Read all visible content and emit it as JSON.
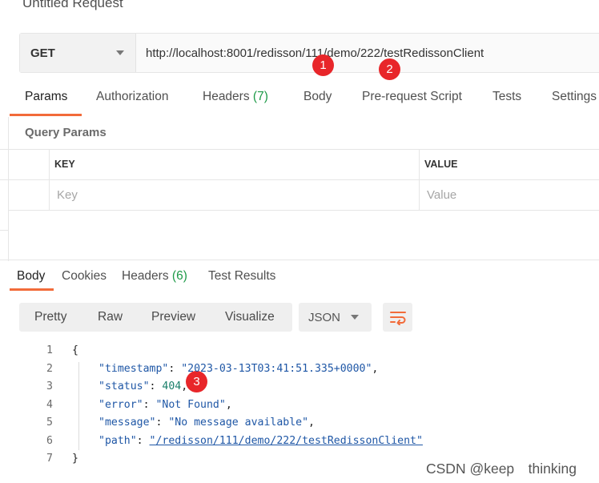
{
  "request": {
    "title": "Untitled Request",
    "method": "GET",
    "url": "http://localhost:8001/redisson/111/demo/222/testRedissonClient"
  },
  "markers": [
    "1",
    "2",
    "3"
  ],
  "request_tabs": [
    {
      "label": "Params",
      "count": ""
    },
    {
      "label": "Authorization",
      "count": ""
    },
    {
      "label": "Headers",
      "count": "(7)"
    },
    {
      "label": "Body",
      "count": ""
    },
    {
      "label": "Pre-request Script",
      "count": ""
    },
    {
      "label": "Tests",
      "count": ""
    },
    {
      "label": "Settings",
      "count": ""
    }
  ],
  "query_params": {
    "title": "Query Params",
    "columns": [
      "KEY",
      "VALUE"
    ],
    "placeholders": [
      "Key",
      "Value"
    ]
  },
  "response_tabs": [
    {
      "label": "Body",
      "count": ""
    },
    {
      "label": "Cookies",
      "count": ""
    },
    {
      "label": "Headers",
      "count": "(6)"
    },
    {
      "label": "Test Results",
      "count": ""
    }
  ],
  "view_modes": [
    "Pretty",
    "Raw",
    "Preview",
    "Visualize"
  ],
  "format": "JSON",
  "icons": {
    "dropdown": "chevron-down-icon",
    "wrap": "wrap-lines-icon"
  },
  "colors": {
    "accent": "#f26b3a",
    "marker": "#e8262a",
    "count": "#1e9a48"
  },
  "response_body": {
    "line_numbers": [
      "1",
      "2",
      "3",
      "4",
      "5",
      "6",
      "7"
    ],
    "open_brace": "{",
    "close_brace": "}",
    "fields": [
      {
        "key": "\"timestamp\"",
        "value": "\"2023-03-13T03:41:51.335+0000\"",
        "sep": ","
      },
      {
        "key": "\"status\"",
        "value": "404",
        "sep": ","
      },
      {
        "key": "\"error\"",
        "value": "\"Not Found\"",
        "sep": ","
      },
      {
        "key": "\"message\"",
        "value": "\"No message available\"",
        "sep": ","
      },
      {
        "key": "\"path\"",
        "value": "\"/redisson/111/demo/222/testRedissonClient\"",
        "sep": ""
      }
    ]
  },
  "watermark": "CSDN @keep　thinking"
}
